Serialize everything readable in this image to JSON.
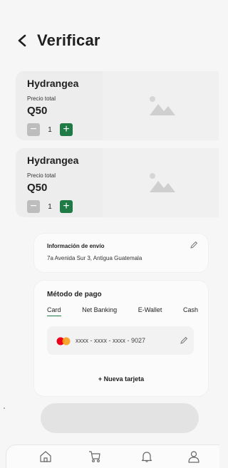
{
  "header": {
    "title": "Verificar"
  },
  "cart": {
    "items": [
      {
        "name": "Hydrangea",
        "price_label": "Precio total",
        "price": "Q50",
        "quantity": "1"
      },
      {
        "name": "Hydrangea",
        "price_label": "Precio total",
        "price": "Q50",
        "quantity": "1"
      }
    ]
  },
  "shipping": {
    "title": "Información de envío",
    "address": "7a Avenida Sur 3, Antigua Guatemala"
  },
  "payment": {
    "title": "Método de pago",
    "tabs": [
      "Card",
      "Net Banking",
      "E-Wallet",
      "Cash"
    ],
    "active_tab": "Card",
    "saved_card": "xxxx - xxxx - xxxx - 9027",
    "new_card_label": "+ Nueva tarjeta"
  },
  "colors": {
    "accent": "#1f7a45",
    "mastercard_red": "#eb001b",
    "mastercard_orange": "#f79e1b"
  },
  "nav": {
    "icons": [
      "home-icon",
      "cart-icon",
      "bell-icon",
      "profile-icon"
    ]
  }
}
